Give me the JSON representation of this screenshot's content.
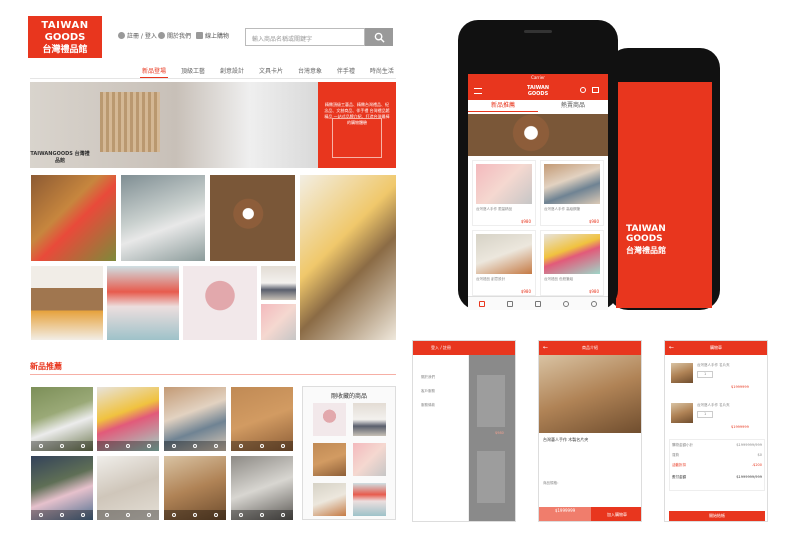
{
  "brand": {
    "line1": "TAIWAN",
    "line2": "GOODS",
    "line3": "台灣禮品館",
    "accent": "#e8361e"
  },
  "header": {
    "login": "註冊 / 登入",
    "lang": "關於我們",
    "cart": "線上購物",
    "search_placeholder": "輸入商品名稱或關鍵字"
  },
  "nav": {
    "items": [
      "新品登場",
      "頂級工藝",
      "創意設計",
      "文具卡片",
      "台灣意象",
      "伴手禮",
      "時尚生活"
    ]
  },
  "hero": {
    "brand_sign": "TAIWANGOODS 台灣禮品館",
    "panel_text": "精緻頂級工藝品、精緻台灣禮品、紀念品、文創商品、伴手禮 台灣禮品館精品 一站式品牌介紹、打造台灣最棒的購物體驗"
  },
  "section": {
    "title": "新品推薦"
  },
  "favorites": {
    "title": "剛收藏的商品"
  },
  "mobile_main": {
    "status": "Carrier",
    "tabs": [
      "新品推薦",
      "熱賣商品"
    ],
    "products": [
      {
        "title": "台灣藝人手作 限量精品",
        "price": "$980"
      },
      {
        "title": "台灣藝人手作 高級鋼筆",
        "price": "$980"
      },
      {
        "title": "台灣禮品 創意設計",
        "price": "$980"
      },
      {
        "title": "台灣禮品 色鉛筆組",
        "price": "$980"
      }
    ]
  },
  "mobile_splash": {
    "line1": "TAIWAN",
    "line2": "GOODS",
    "line3": "台灣禮品館"
  },
  "screen_menu": {
    "header": "登入 / 註冊",
    "items": [
      "關於我們",
      "客戶服務",
      "服務條款"
    ],
    "price": "$980"
  },
  "screen_product": {
    "header": "商品介紹",
    "name": "台灣藝人手作 木製名片夾",
    "desc": "商品規格：",
    "price": "$1999999",
    "price_sub": "加入購物車",
    "cta": "加入購物車"
  },
  "screen_cart": {
    "header": "購物車",
    "items": [
      {
        "title": "台灣藝人手作 名片夾",
        "qty": "1",
        "price": "$1999999"
      },
      {
        "title": "台灣藝人手作 名片夾",
        "qty": "1",
        "price": "$1999999"
      }
    ],
    "summary": [
      {
        "label": "購物金額小計",
        "value": "$1999999/999"
      },
      {
        "label": "運費",
        "value": "$0"
      },
      {
        "label": "活動折扣",
        "value": "-$200"
      },
      {
        "label": "應付金額",
        "value": "$1999999/999"
      }
    ],
    "cta": "開始結帳"
  }
}
